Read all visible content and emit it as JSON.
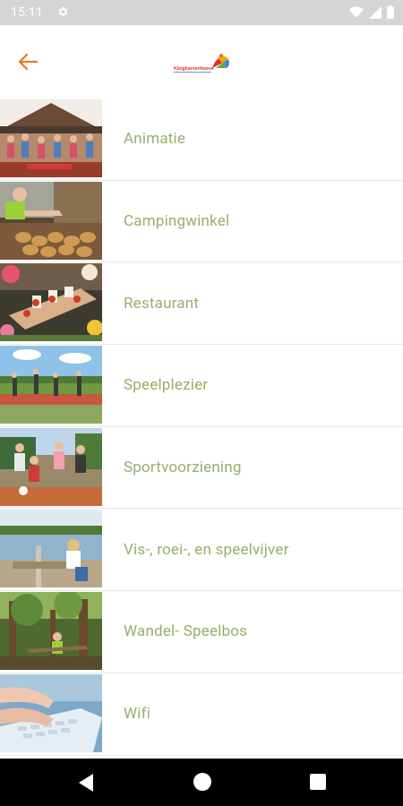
{
  "status_bar": {
    "time": "15:11",
    "icons": [
      "settings-gear-icon",
      "wifi-icon",
      "signal-icon",
      "battery-icon"
    ]
  },
  "app_bar": {
    "back_icon": "arrow-left-icon",
    "accent_color": "#e87722",
    "logo_icon": "camping-logo-icon"
  },
  "list": {
    "text_color": "#96ae6e",
    "items": [
      {
        "label": "Animatie",
        "image": "animation-stage-photo"
      },
      {
        "label": "Campingwinkel",
        "image": "bread-rolls-shop-photo"
      },
      {
        "label": "Restaurant",
        "image": "food-platter-photo"
      },
      {
        "label": "Speelplezier",
        "image": "kids-playing-field-photo"
      },
      {
        "label": "Sportvoorziening",
        "image": "kids-sports-court-photo"
      },
      {
        "label": "Vis-, roei-, en speelvijver",
        "image": "pond-fishing-photo"
      },
      {
        "label": "Wandel- Speelbos",
        "image": "forest-play-photo"
      },
      {
        "label": "Wifi",
        "image": "laptop-typing-photo"
      }
    ]
  },
  "nav_bar": {
    "icons": [
      "nav-back-icon",
      "nav-home-icon",
      "nav-recents-icon"
    ]
  }
}
